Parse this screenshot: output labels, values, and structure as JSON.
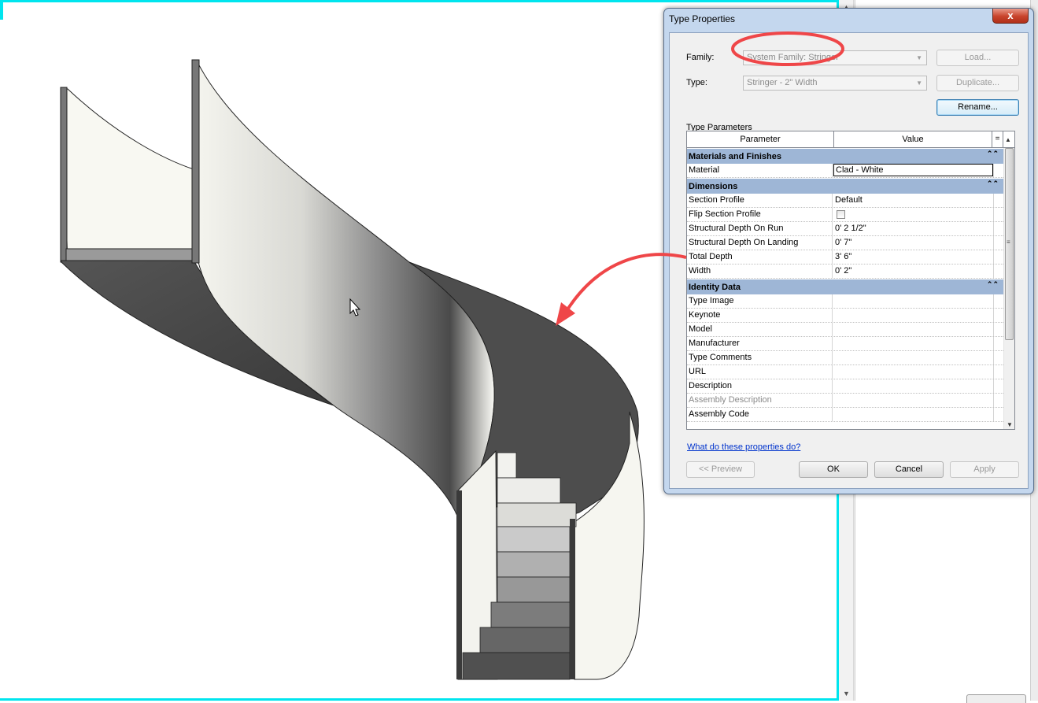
{
  "dialog": {
    "title": "Type Properties",
    "close_label": "x",
    "family_label": "Family:",
    "family_value": "System Family: Stringer",
    "type_label": "Type:",
    "type_value": "Stringer - 2\" Width",
    "load_label": "Load...",
    "duplicate_label": "Duplicate...",
    "rename_label": "Rename...",
    "type_parameters_label": "Type Parameters",
    "columns": {
      "parameter": "Parameter",
      "value": "Value",
      "extra": "="
    },
    "groups": {
      "materials": "Materials and Finishes",
      "dimensions": "Dimensions",
      "identity": "Identity Data"
    },
    "rows": {
      "material": {
        "name": "Material",
        "value": "Clad - White"
      },
      "section_profile": {
        "name": "Section Profile",
        "value": "Default"
      },
      "flip_section_profile": {
        "name": "Flip Section Profile",
        "value": ""
      },
      "depth_on_run": {
        "name": "Structural Depth On Run",
        "value": "0'  2 1/2\""
      },
      "depth_on_landing": {
        "name": "Structural Depth On Landing",
        "value": "0'  7\""
      },
      "total_depth": {
        "name": "Total Depth",
        "value": "3'  6\""
      },
      "width": {
        "name": "Width",
        "value": "0'  2\""
      },
      "type_image": {
        "name": "Type Image",
        "value": ""
      },
      "keynote": {
        "name": "Keynote",
        "value": ""
      },
      "model": {
        "name": "Model",
        "value": ""
      },
      "manufacturer": {
        "name": "Manufacturer",
        "value": ""
      },
      "type_comments": {
        "name": "Type Comments",
        "value": ""
      },
      "url": {
        "name": "URL",
        "value": ""
      },
      "description": {
        "name": "Description",
        "value": ""
      },
      "assembly_description": {
        "name": "Assembly Description",
        "value": ""
      },
      "assembly_code": {
        "name": "Assembly Code",
        "value": ""
      }
    },
    "help_link": "What do these properties do?",
    "preview_label": "<< Preview",
    "ok_label": "OK",
    "cancel_label": "Cancel",
    "apply_label": "Apply"
  },
  "colors": {
    "viewport_border": "#00e5ee",
    "annotation": "#ef4648",
    "group_header": "#9eb6d6"
  }
}
